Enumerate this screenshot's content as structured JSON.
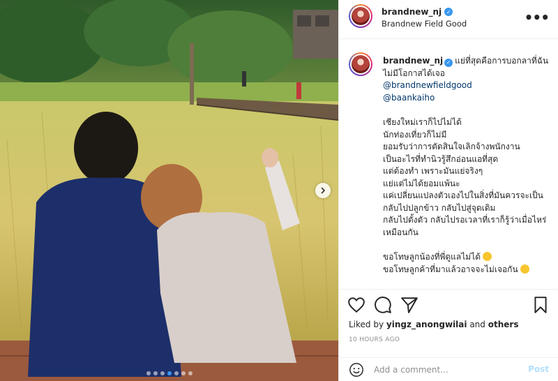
{
  "post": {
    "username": "brandnew_nj",
    "location": "Brandnew Field Good",
    "more_icon": "more-horizontal-icon"
  },
  "caption": {
    "username": "brandnew_nj",
    "first_line": "แย่ที่สุดคือการบอกลาที่ฉันไม่มีโอกาสได้เจอ",
    "mentions": [
      "@brandnewfieldgood",
      "@baankaiho"
    ],
    "paragraph": [
      "เชียงใหม่เราก็ไปไม่ได้",
      "นักท่องเที่ยวก็ไม่มี",
      "ยอมรับว่าการตัดสินใจเลิกจ้างพนักงาน",
      "เป็นอะไรที่ทำนิวรู้สึกอ่อนแอที่สุด",
      "แต่ต้องทำ เพราะมันแย่จริงๆ",
      "แย่แต่ไม่ได้ยอมแพ้นะ",
      "แค่เปลี่ยนแปลงตัวเองไปในสิ่งที่มันควรจะเป็น",
      "กลับไปปลูกข้าว กลับไปสู่จุดเดิม",
      "กลับไปตั้งตัว กลับไปรอเวลาที่เราก็รู้ว่าเมื่อไหร่เหมือนกัน"
    ],
    "closing": [
      "ขอโทษลูกน้องที่พี่ดูแลไม่ได้",
      "ขอโทษลูกค้าที่มาแล้วอาจจะไม่เจอกัน"
    ]
  },
  "likes": {
    "prefix": "Liked by",
    "user": "yingz_anongwilai",
    "and": "and",
    "others": "others"
  },
  "timestamp": "10 HOURS AGO",
  "comment": {
    "placeholder": "Add a comment...",
    "post_label": "Post"
  },
  "carousel": {
    "count": 7,
    "active_index": 3
  },
  "colors": {
    "accent": "#3897f0",
    "link": "#00376b",
    "post_disabled": "#b2dffc",
    "muted": "#8e8e8e"
  }
}
